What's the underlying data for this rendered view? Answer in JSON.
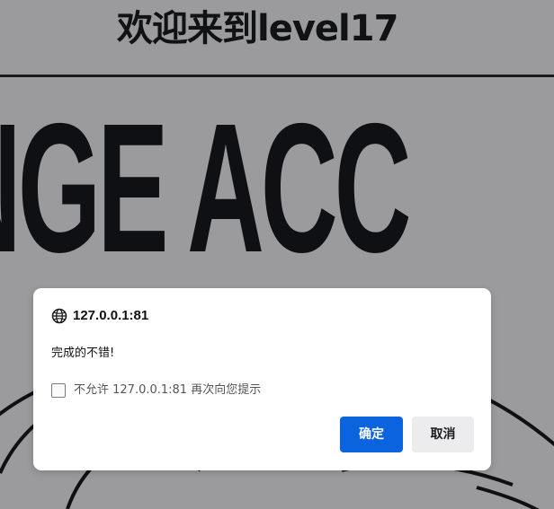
{
  "page": {
    "title": "欢迎来到level17",
    "background_banner_text": "NGE ACC"
  },
  "dialog": {
    "origin": "127.0.0.1:81",
    "message": "完成的不错!",
    "suppress_checkbox_label": "不允许 127.0.0.1:81 再次向您提示",
    "suppress_checked": false,
    "confirm_label": "确定",
    "cancel_label": "取消",
    "icon": "globe-icon"
  },
  "colors": {
    "overlay_background": "#9b9b9d",
    "primary_button": "#0b63dd",
    "secondary_button": "#ececef",
    "dialog_background": "#ffffff"
  }
}
